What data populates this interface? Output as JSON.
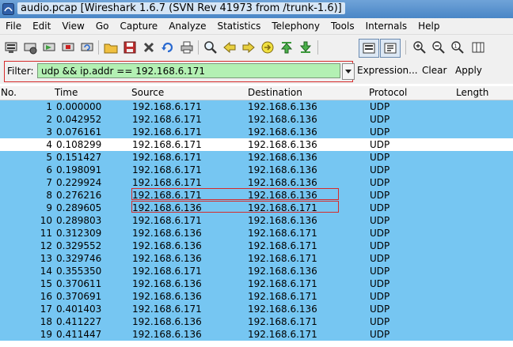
{
  "window": {
    "title": "audio.pcap   [Wireshark 1.6.7  (SVN Rev 41973 from /trunk-1.6)]"
  },
  "menu": [
    "File",
    "Edit",
    "View",
    "Go",
    "Capture",
    "Analyze",
    "Statistics",
    "Telephony",
    "Tools",
    "Internals",
    "Help"
  ],
  "toolbar_icons": [
    "interface-list-icon",
    "capture-options-icon",
    "start-capture-icon",
    "stop-capture-icon",
    "restart-capture-icon",
    "open-file-icon",
    "save-file-icon",
    "close-file-icon",
    "reload-icon",
    "print-icon",
    "find-packet-icon",
    "go-back-icon",
    "go-forward-icon",
    "go-to-packet-icon",
    "go-first-icon",
    "go-last-icon",
    "colorize-icon",
    "auto-scroll-icon",
    "zoom-in-icon",
    "zoom-out-icon",
    "zoom-normal-icon",
    "resize-columns-icon"
  ],
  "filter": {
    "label": "Filter:",
    "value": "udp && ip.addr == 192.168.6.171",
    "expression_label": "Expression...",
    "clear_label": "Clear",
    "apply_label": "Apply"
  },
  "columns": [
    "No.",
    "Time",
    "Source",
    "Destination",
    "Protocol",
    "Length"
  ],
  "colors": {
    "row_blue": "#76c6f2",
    "row_white": "#ffffff",
    "highlight_red": "#d62b2b",
    "filter_green": "#b3f0b3"
  },
  "packets": [
    {
      "no": "1",
      "time": "0.000000",
      "src": "192.168.6.171",
      "dst": "192.168.6.136",
      "proto": "UDP",
      "style": "blue"
    },
    {
      "no": "2",
      "time": "0.042952",
      "src": "192.168.6.171",
      "dst": "192.168.6.136",
      "proto": "UDP",
      "style": "blue"
    },
    {
      "no": "3",
      "time": "0.076161",
      "src": "192.168.6.171",
      "dst": "192.168.6.136",
      "proto": "UDP",
      "style": "blue"
    },
    {
      "no": "4",
      "time": "0.108299",
      "src": "192.168.6.171",
      "dst": "192.168.6.136",
      "proto": "UDP",
      "style": "white"
    },
    {
      "no": "5",
      "time": "0.151427",
      "src": "192.168.6.171",
      "dst": "192.168.6.136",
      "proto": "UDP",
      "style": "blue"
    },
    {
      "no": "6",
      "time": "0.198091",
      "src": "192.168.6.171",
      "dst": "192.168.6.136",
      "proto": "UDP",
      "style": "blue"
    },
    {
      "no": "7",
      "time": "0.229924",
      "src": "192.168.6.171",
      "dst": "192.168.6.136",
      "proto": "UDP",
      "style": "blue"
    },
    {
      "no": "8",
      "time": "0.276216",
      "src": "192.168.6.171",
      "dst": "192.168.6.136",
      "proto": "UDP",
      "style": "blue"
    },
    {
      "no": "9",
      "time": "0.289605",
      "src": "192.168.6.136",
      "dst": "192.168.6.171",
      "proto": "UDP",
      "style": "blue"
    },
    {
      "no": "10",
      "time": "0.289803",
      "src": "192.168.6.171",
      "dst": "192.168.6.136",
      "proto": "UDP",
      "style": "blue"
    },
    {
      "no": "11",
      "time": "0.312309",
      "src": "192.168.6.136",
      "dst": "192.168.6.171",
      "proto": "UDP",
      "style": "blue"
    },
    {
      "no": "12",
      "time": "0.329552",
      "src": "192.168.6.136",
      "dst": "192.168.6.171",
      "proto": "UDP",
      "style": "blue"
    },
    {
      "no": "13",
      "time": "0.329746",
      "src": "192.168.6.136",
      "dst": "192.168.6.171",
      "proto": "UDP",
      "style": "blue"
    },
    {
      "no": "14",
      "time": "0.355350",
      "src": "192.168.6.171",
      "dst": "192.168.6.136",
      "proto": "UDP",
      "style": "blue"
    },
    {
      "no": "15",
      "time": "0.370611",
      "src": "192.168.6.136",
      "dst": "192.168.6.171",
      "proto": "UDP",
      "style": "blue"
    },
    {
      "no": "16",
      "time": "0.370691",
      "src": "192.168.6.136",
      "dst": "192.168.6.171",
      "proto": "UDP",
      "style": "blue"
    },
    {
      "no": "17",
      "time": "0.401403",
      "src": "192.168.6.171",
      "dst": "192.168.6.136",
      "proto": "UDP",
      "style": "blue"
    },
    {
      "no": "18",
      "time": "0.411227",
      "src": "192.168.6.136",
      "dst": "192.168.6.171",
      "proto": "UDP",
      "style": "blue"
    },
    {
      "no": "19",
      "time": "0.411447",
      "src": "192.168.6.136",
      "dst": "192.168.6.171",
      "proto": "UDP",
      "style": "blue"
    }
  ]
}
